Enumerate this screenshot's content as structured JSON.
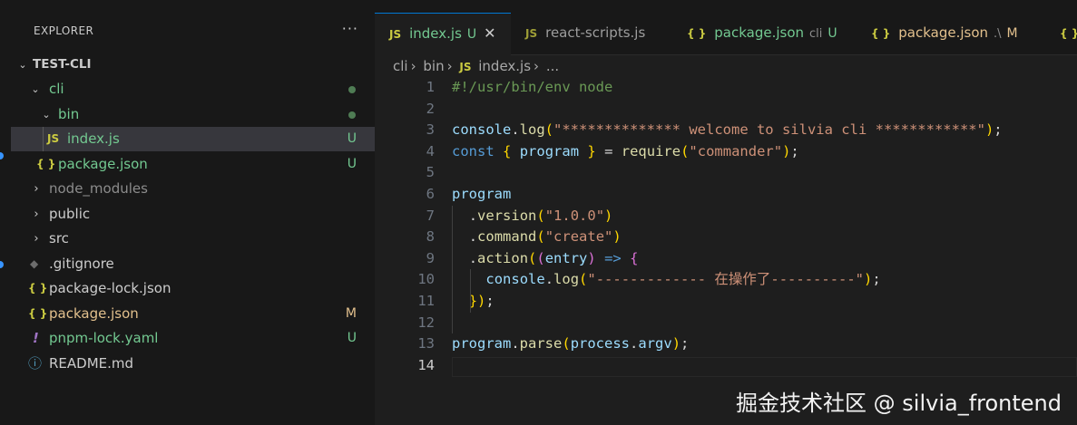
{
  "sidebar": {
    "title": "EXPLORER",
    "more": "···",
    "root": {
      "label": "TEST-CLI"
    },
    "items": [
      {
        "label": "cli",
        "type": "folder",
        "expanded": true,
        "status": "",
        "modified_dot": true,
        "color": "#73c991"
      },
      {
        "label": "bin",
        "type": "folder",
        "expanded": true,
        "status": "",
        "modified_dot": true,
        "color": "#73c991"
      },
      {
        "label": "index.js",
        "type": "file",
        "icon": "JS",
        "status": "U",
        "color": "#73c991",
        "selected": true
      },
      {
        "label": "package.json",
        "type": "file",
        "icon": "{ }",
        "status": "U",
        "color": "#73c991"
      },
      {
        "label": "node_modules",
        "type": "folder",
        "expanded": false,
        "status": "",
        "color": "#8c8c8c"
      },
      {
        "label": "public",
        "type": "folder",
        "expanded": false,
        "status": "",
        "color": "#cccccc"
      },
      {
        "label": "src",
        "type": "folder",
        "expanded": false,
        "status": "",
        "color": "#cccccc"
      },
      {
        "label": ".gitignore",
        "type": "file",
        "icon": "◆",
        "status": "",
        "color": "#cccccc"
      },
      {
        "label": "package-lock.json",
        "type": "file",
        "icon": "{ }",
        "status": "",
        "color": "#cccccc"
      },
      {
        "label": "package.json",
        "type": "file",
        "icon": "{ }",
        "status": "M",
        "color": "#e2c08d"
      },
      {
        "label": "pnpm-lock.yaml",
        "type": "file",
        "icon": "!",
        "status": "U",
        "color": "#73c991"
      },
      {
        "label": "README.md",
        "type": "file",
        "icon": "ⓘ",
        "status": "",
        "color": "#cccccc"
      }
    ]
  },
  "tabs": [
    {
      "icon": "JS",
      "label": "index.js",
      "status": "U",
      "close": "✕",
      "active": true
    },
    {
      "icon": "JS",
      "label": "react-scripts.js",
      "status": "",
      "active": false
    },
    {
      "icon": "{ }",
      "label": "package.json",
      "desc": "cli",
      "status": "U",
      "active": false
    },
    {
      "icon": "{ }",
      "label": "package.json",
      "desc": ".\\",
      "status": "M",
      "active": false
    },
    {
      "icon": "{ }",
      "label": "",
      "status": "",
      "active": false
    }
  ],
  "breadcrumb": {
    "parts": [
      "cli",
      "bin",
      "index.js",
      "..."
    ],
    "file_icon": "JS"
  },
  "code": {
    "active_line": 14,
    "lines": [
      {
        "n": "1",
        "text": "#!/usr/bin/env node"
      },
      {
        "n": "2",
        "text": ""
      },
      {
        "n": "3",
        "text": "console.log(\"************** welcome to silvia cli ************\");"
      },
      {
        "n": "4",
        "text": "const { program } = require(\"commander\");"
      },
      {
        "n": "5",
        "text": ""
      },
      {
        "n": "6",
        "text": "program"
      },
      {
        "n": "7",
        "text": "  .version(\"1.0.0\")"
      },
      {
        "n": "8",
        "text": "  .command(\"create\")"
      },
      {
        "n": "9",
        "text": "  .action((entry) => {"
      },
      {
        "n": "10",
        "text": "    console.log(\"------------- 在操作了----------\");"
      },
      {
        "n": "11",
        "text": "  });"
      },
      {
        "n": "12",
        "text": ""
      },
      {
        "n": "13",
        "text": "program.parse(process.argv);"
      },
      {
        "n": "14",
        "text": ""
      }
    ]
  },
  "watermark": "掘金技术社区 @ silvia_frontend",
  "colors": {
    "untracked": "#73c991",
    "modified": "#e2c08d",
    "js_icon": "#cbcb41",
    "json_icon": "#cbcb41",
    "yaml_icon": "#a074c4",
    "accent": "#0078d4"
  }
}
